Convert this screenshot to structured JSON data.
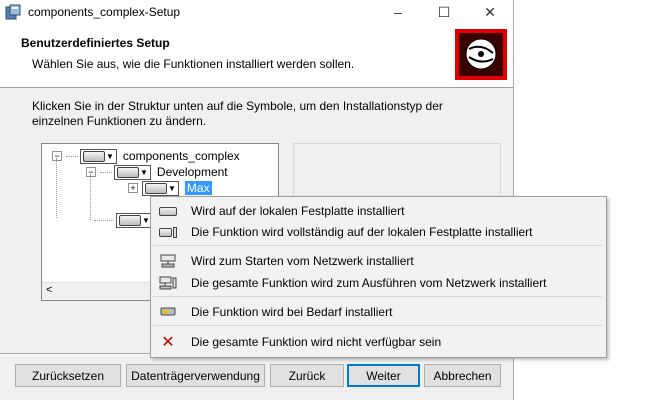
{
  "window": {
    "title": "components_complex-Setup",
    "controls": [
      "–",
      "☐",
      "✕"
    ]
  },
  "banner": {
    "title": "Benutzerdefiniertes Setup",
    "subtitle": "Wählen Sie aus, wie die Funktionen installiert werden sollen."
  },
  "description": "Klicken Sie in der Struktur unten auf die Symbole, um den Installationstyp der einzelnen Funktionen zu ändern.",
  "tree": {
    "items": [
      {
        "label": "components_complex"
      },
      {
        "label": "Development"
      },
      {
        "label": "Max"
      }
    ],
    "scroll_left": "<"
  },
  "context_menu": {
    "items": [
      {
        "label": "Wird auf der lokalen Festplatte installiert",
        "icon": "local-drive-icon"
      },
      {
        "label": "Die Funktion wird vollständig auf der lokalen Festplatte installiert",
        "icon": "local-drive-full-icon"
      },
      {
        "label": "Wird zum Starten vom Netzwerk installiert",
        "icon": "network-icon"
      },
      {
        "label": "Die gesamte Funktion wird zum Ausführen vom Netzwerk installiert",
        "icon": "network-full-icon"
      },
      {
        "label": "Die Funktion wird bei Bedarf installiert",
        "icon": "on-demand-icon"
      },
      {
        "label": "Die gesamte Funktion wird nicht verfügbar sein",
        "icon": "unavailable-x-icon"
      }
    ]
  },
  "buttons": {
    "reset": "Zurücksetzen",
    "disk_usage": "Datenträgerverwendung",
    "back": "Zurück",
    "next": "Weiter",
    "cancel": "Abbrechen"
  },
  "colors": {
    "selection": "#3399ff",
    "logo_red": "#e00000",
    "unavailable_x": "#c00000"
  }
}
